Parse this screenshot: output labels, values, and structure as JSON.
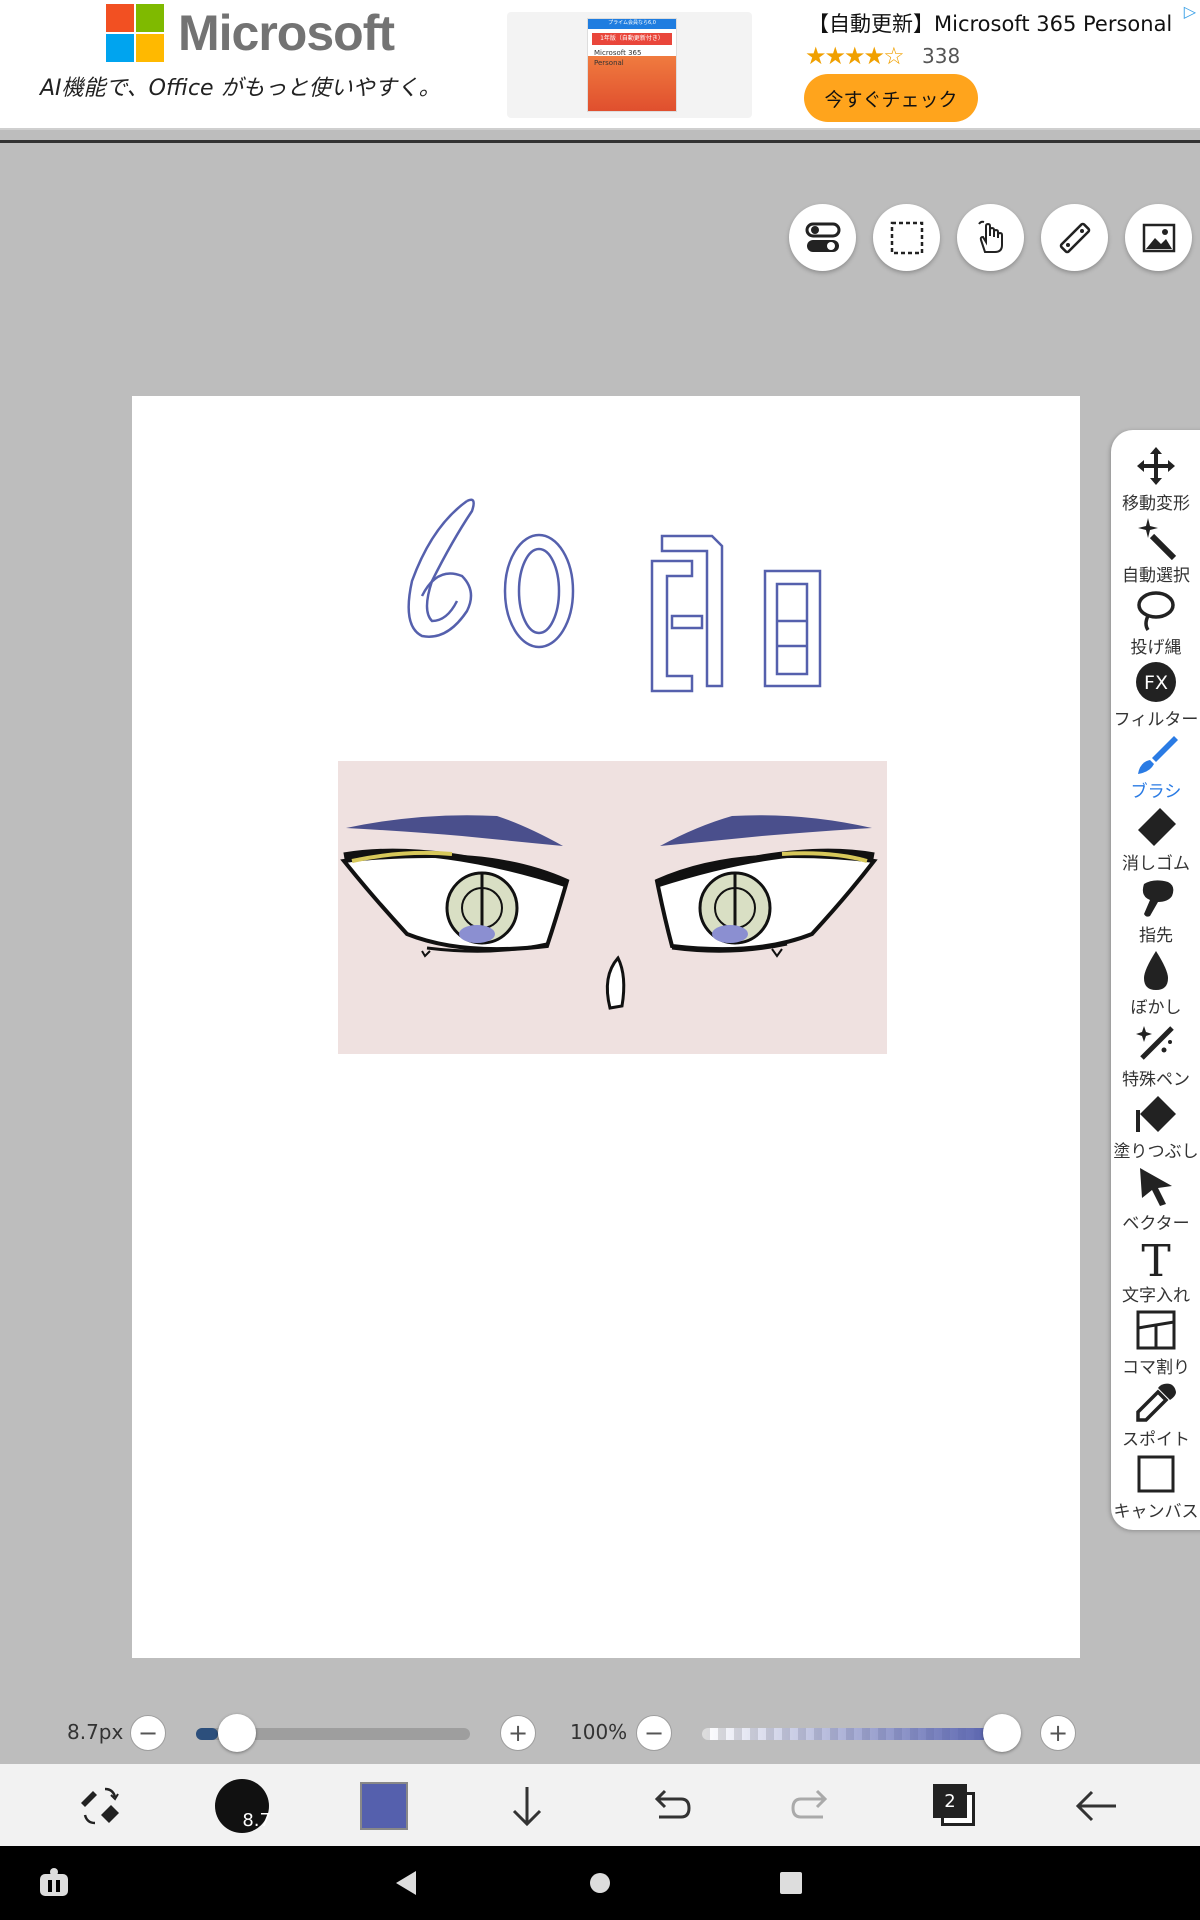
{
  "ad": {
    "brand": "Microsoft",
    "tagline": "AI機能で、Office がもっと使いやすく。",
    "title": "【自動更新】Microsoft 365 Personal...",
    "stars": "★★★★☆",
    "review_count": "338",
    "cta": "今すぐチェック",
    "box_text_1": "プライム会員なら6,0",
    "box_text_2": "1年版（自動更新付き）",
    "box_text_3": "Microsoft 365",
    "box_text_4": "Personal"
  },
  "top_tools": [
    {
      "name": "toggle-icon"
    },
    {
      "name": "selection-icon"
    },
    {
      "name": "hand-icon"
    },
    {
      "name": "ruler-icon"
    },
    {
      "name": "image-icon"
    }
  ],
  "canvas": {
    "drawing_text": "60日"
  },
  "palette": {
    "items": [
      {
        "label": "移動変形",
        "icon": "move-icon"
      },
      {
        "label": "自動選択",
        "icon": "magic-wand-icon"
      },
      {
        "label": "投げ縄",
        "icon": "lasso-icon"
      },
      {
        "label": "フィルター",
        "icon": "fx-icon"
      },
      {
        "label": "ブラシ",
        "icon": "brush-icon"
      },
      {
        "label": "消しゴム",
        "icon": "eraser-icon"
      },
      {
        "label": "指先",
        "icon": "finger-icon"
      },
      {
        "label": "ぼかし",
        "icon": "blur-icon"
      },
      {
        "label": "特殊ペン",
        "icon": "special-pen-icon"
      },
      {
        "label": "塗りつぶし",
        "icon": "fill-icon"
      },
      {
        "label": "ベクター",
        "icon": "vector-icon"
      },
      {
        "label": "文字入れ",
        "icon": "text-icon"
      },
      {
        "label": "コマ割り",
        "icon": "frame-icon"
      },
      {
        "label": "スポイト",
        "icon": "eyedropper-icon"
      },
      {
        "label": "キャンバス",
        "icon": "canvas-icon"
      }
    ],
    "fx_text": "FX",
    "text_glyph": "T",
    "active": "ブラシ"
  },
  "sliders": {
    "brush_size": "8.7px",
    "brush_size_fraction": 0.08,
    "opacity": "100%",
    "opacity_fraction": 1.0,
    "minus": "−",
    "plus": "+"
  },
  "bottom": {
    "brush_size_badge": "8.7",
    "color": "#5560ad",
    "layer_count": "2"
  },
  "colors": {
    "accent": "#2a7be4",
    "brush_color": "#5560ad",
    "cta": "#ffa41c"
  }
}
